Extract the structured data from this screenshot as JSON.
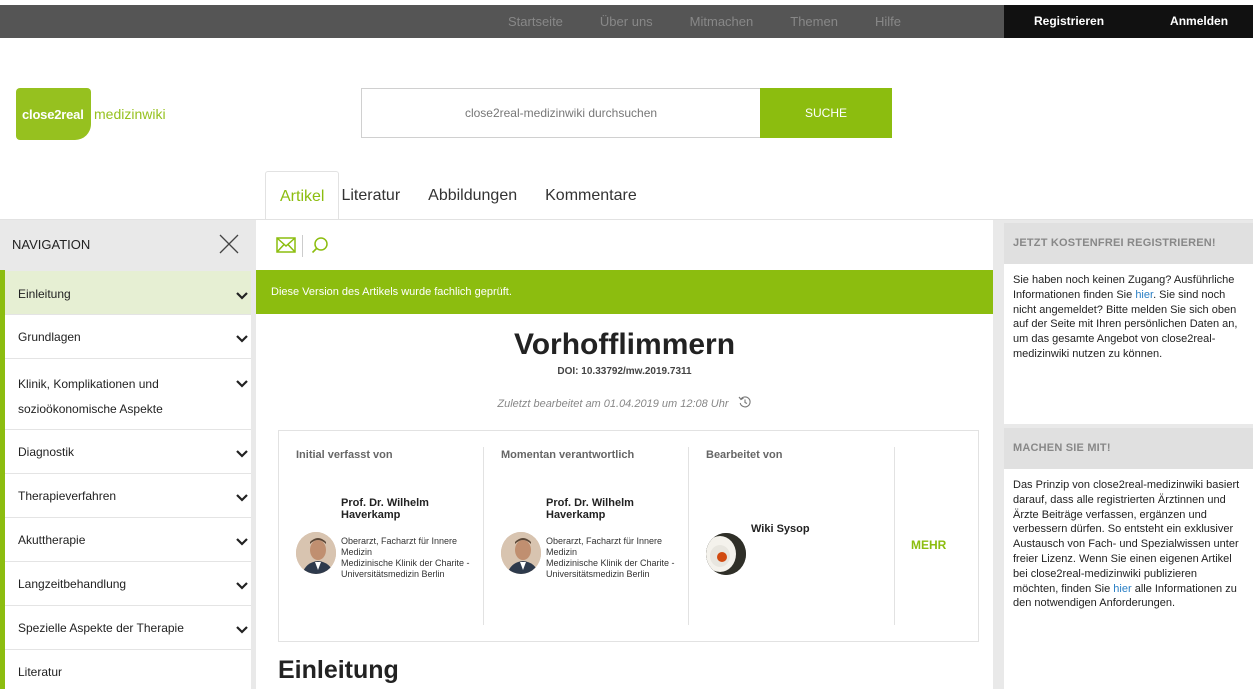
{
  "topnav": {
    "items": [
      "Startseite",
      "Über uns",
      "Mitmachen",
      "Themen",
      "Hilfe"
    ],
    "register": "Registrieren",
    "login": "Anmelden"
  },
  "logo": {
    "brand": "close2real",
    "suffix": "medizinwiki"
  },
  "search": {
    "placeholder": "close2real-medizinwiki durchsuchen",
    "button": "SUCHE"
  },
  "tabs": [
    "Artikel",
    "Literatur",
    "Abbildungen",
    "Kommentare"
  ],
  "nav": {
    "title": "NAVIGATION",
    "items": [
      {
        "label": "Einleitung",
        "active": true
      },
      {
        "label": "Grundlagen"
      },
      {
        "label": "Klinik, Komplikationen und sozioökonomische Aspekte"
      },
      {
        "label": "Diagnostik"
      },
      {
        "label": "Therapieverfahren"
      },
      {
        "label": "Akuttherapie"
      },
      {
        "label": "Langzeitbehandlung"
      },
      {
        "label": "Spezielle Aspekte der Therapie"
      },
      {
        "label": "Literatur"
      }
    ]
  },
  "article": {
    "verified": "Diese Version des Artikels wurde fachlich geprüft.",
    "title": "Vorhofflimmern",
    "doi": "DOI: 10.33792/mw.2019.7311",
    "edited": "Zuletzt bearbeitet am 01.04.2019 um 12:08 Uhr",
    "section_heading": "Einleitung"
  },
  "authors": {
    "col1": {
      "heading": "Initial verfasst von",
      "name": "Prof. Dr. Wilhelm Haverkamp",
      "desc": [
        "Oberarzt, Facharzt für Innere Medizin",
        "Medizinische Klinik der Charite - Universitätsmedizin Berlin"
      ]
    },
    "col2": {
      "heading": "Momentan verantwortlich",
      "name": "Prof. Dr. Wilhelm Haverkamp",
      "desc": [
        "Oberarzt, Facharzt für Innere Medizin",
        "Medizinische Klinik der Charite - Universitätsmedizin Berlin"
      ]
    },
    "col3": {
      "heading": "Bearbeitet von",
      "name": "Wiki Sysop"
    },
    "more": "MEHR"
  },
  "sidebar": {
    "register": {
      "heading": "JETZT KOSTENFREI REGISTRIEREN!",
      "text1": "Sie haben noch keinen Zugang? Ausführliche Informationen finden Sie",
      "link": "hier",
      "text2": ". Sie sind noch nicht angemeldet? Bitte melden Sie sich oben auf der Seite mit Ihren persönlichen Daten an, um das gesamte Angebot von close2real-medizinwiki nutzen zu können."
    },
    "join": {
      "heading": "MACHEN SIE MIT!",
      "text1": "Das Prinzip von close2real-medizinwiki basiert darauf, dass alle registrierten Ärztinnen und Ärzte Beiträge verfassen, ergänzen und verbessern dürfen. So entsteht ein exklusiver Austausch von Fach- und Spezialwissen unter freier Lizenz. Wenn Sie einen eigenen Artikel bei close2real-medizinwiki publizieren möchten, finden Sie",
      "link": "hier",
      "text2": " alle Informationen zu den notwendigen Anforderungen."
    }
  },
  "colors": {
    "accent": "#8cbd0f",
    "topbar": "#555555",
    "account": "#111111",
    "link": "#2a7fc5"
  },
  "icons": [
    "close-icon",
    "chevron-down-icon",
    "mail-icon",
    "search-icon",
    "history-icon"
  ]
}
